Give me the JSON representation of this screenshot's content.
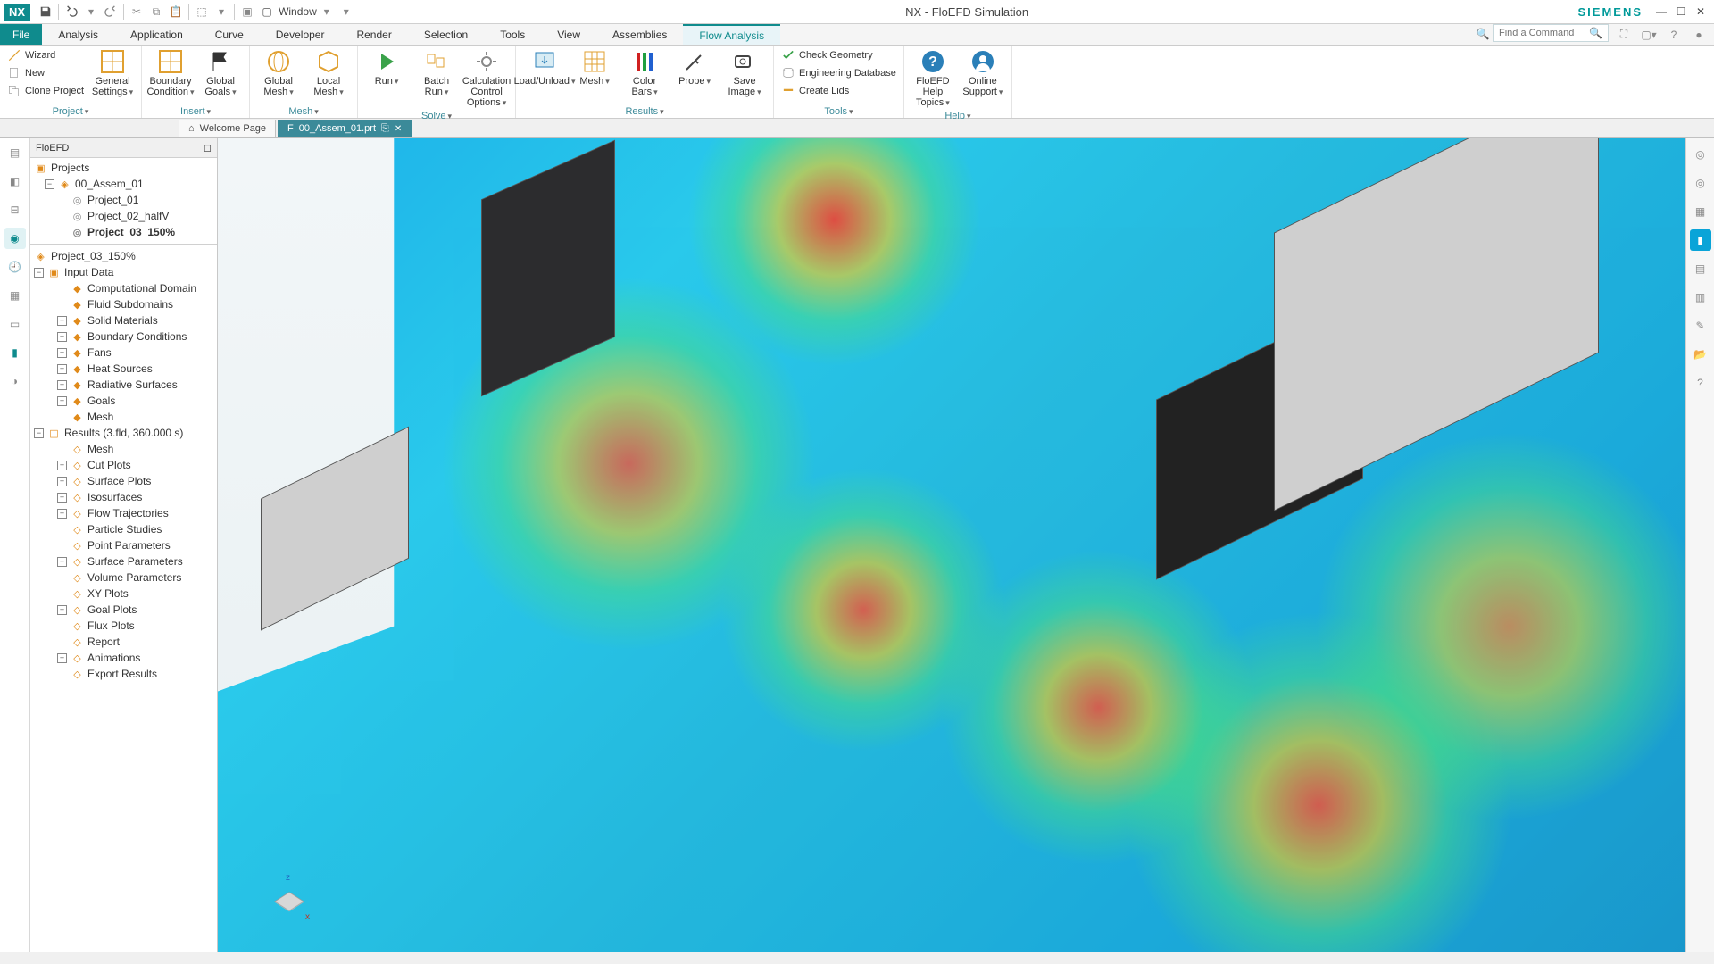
{
  "app": {
    "title": "NX - FloEFD Simulation",
    "brand": "SIEMENS"
  },
  "quick_access": {
    "window_label": "Window"
  },
  "menus": {
    "file": "File",
    "items": [
      "Analysis",
      "Application",
      "Curve",
      "Developer",
      "Render",
      "Selection",
      "Tools",
      "View",
      "Assemblies",
      "Flow Analysis"
    ],
    "active_index": 9
  },
  "search": {
    "placeholder": "Find a Command"
  },
  "ribbon": {
    "groups": [
      {
        "name": "Project",
        "items": [
          {
            "type": "small",
            "label": "Wizard"
          },
          {
            "type": "small",
            "label": "New"
          },
          {
            "type": "small",
            "label": "Clone Project"
          },
          {
            "type": "big",
            "label": "General\nSettings"
          }
        ]
      },
      {
        "name": "Insert",
        "items": [
          {
            "type": "big",
            "label": "Boundary\nCondition"
          },
          {
            "type": "big",
            "label": "Global\nGoals"
          }
        ]
      },
      {
        "name": "Mesh",
        "items": [
          {
            "type": "big",
            "label": "Global\nMesh"
          },
          {
            "type": "big",
            "label": "Local\nMesh"
          }
        ]
      },
      {
        "name": "Solve",
        "items": [
          {
            "type": "big",
            "label": "Run"
          },
          {
            "type": "big",
            "label": "Batch\nRun"
          },
          {
            "type": "big",
            "label": "Calculation\nControl Options"
          }
        ]
      },
      {
        "name": "Results",
        "items": [
          {
            "type": "big",
            "label": "Load/Unload"
          },
          {
            "type": "big",
            "label": "Mesh"
          },
          {
            "type": "big",
            "label": "Color\nBars"
          },
          {
            "type": "big",
            "label": "Probe"
          },
          {
            "type": "big",
            "label": "Save\nImage"
          }
        ]
      },
      {
        "name": "Tools",
        "items": [
          {
            "type": "small",
            "label": "Check Geometry"
          },
          {
            "type": "small",
            "label": "Engineering Database"
          },
          {
            "type": "small",
            "label": "Create Lids"
          }
        ]
      },
      {
        "name": "Help",
        "items": [
          {
            "type": "big",
            "label": "FloEFD Help\nTopics"
          },
          {
            "type": "big",
            "label": "Online\nSupport"
          }
        ]
      }
    ]
  },
  "doc_tabs": {
    "welcome": "Welcome Page",
    "active": "00_Assem_01.prt"
  },
  "left_panel": {
    "title": "FloEFD",
    "projects_root": "Projects",
    "assembly": "00_Assem_01",
    "projects": [
      "Project_01",
      "Project_02_halfV",
      "Project_03_150%"
    ],
    "active_project_index": 2,
    "active_project_header": "Project_03_150%",
    "input_root": "Input Data",
    "input_items": [
      "Computational Domain",
      "Fluid Subdomains",
      "Solid Materials",
      "Boundary Conditions",
      "Fans",
      "Heat Sources",
      "Radiative Surfaces",
      "Goals",
      "Mesh"
    ],
    "results_root": "Results (3.fld, 360.000 s)",
    "results_items": [
      "Mesh",
      "Cut Plots",
      "Surface Plots",
      "Isosurfaces",
      "Flow Trajectories",
      "Particle Studies",
      "Point Parameters",
      "Surface Parameters",
      "Volume Parameters",
      "XY Plots",
      "Goal Plots",
      "Flux Plots",
      "Report",
      "Animations",
      "Export Results"
    ]
  },
  "triad": {
    "x": "x",
    "y": "",
    "z": "z"
  }
}
